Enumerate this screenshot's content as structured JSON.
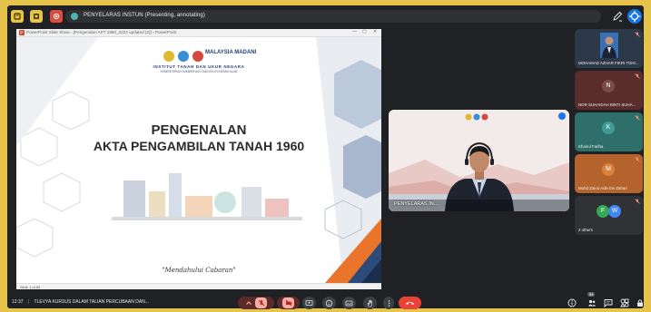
{
  "colors": {
    "frame_border": "#e6c44b",
    "background": "#202124",
    "accent_blue": "#1a73e8",
    "end_call_red": "#ea4335",
    "tile_maroon": "#5a2d2c",
    "tile_teal": "#2e6f6a",
    "tile_orange": "#b3632b"
  },
  "topbar": {
    "presenting_label": "PENYELARAS INSTUN (Presenting, annotating)",
    "icons": [
      "file-icon",
      "board-icon",
      "record-icon",
      "pen-icon",
      "annotate-icon"
    ]
  },
  "presentation": {
    "window_title": "PowerPoint Slide Show - [Pengenalan APT 1960_2024 updated (2)] - PowerPoint",
    "slide": {
      "logo_text": "MALAYSIA MADANI",
      "org_name": "INSTITUT TANAH DAN UKUR NEGARA",
      "org_sub": "KEMENTERIAN SUMBER ASLI DAN KELESTARIAN ALAM",
      "title_line1": "PENGENALAN",
      "title_line2": "AKTA PENGAMBILAN TANAH 1960",
      "motto": "\"Mendahului Cabaran\""
    },
    "status": "Slide 1 of 50"
  },
  "presenter": {
    "name": "PENYELARAS IN..."
  },
  "participants": [
    {
      "name": "MOHAMAD AZHAR FIKRI TOHI...",
      "initial": "",
      "mic": "muted"
    },
    {
      "name": "NOR SUHAIDAH BINTI SUHA...",
      "initial": "N",
      "mic": "muted"
    },
    {
      "name": "Khairul Fariha",
      "initial": "K",
      "mic": "muted"
    },
    {
      "name": "Mohd Zairul Adin bin Zahari",
      "initial": "M",
      "mic": "muted"
    },
    {
      "name": "2 others",
      "initials": [
        "F",
        "W"
      ],
      "mic": "muted"
    }
  ],
  "bottom": {
    "time": "12:37",
    "separator": "|",
    "meeting_name": "TLEVYA KURSUS DALAM TALIAN PERCUBAAN DAN...",
    "participant_count": "99",
    "controls": [
      "mic-options",
      "mic-off",
      "camera-options",
      "camera-off",
      "present",
      "emoji",
      "captions",
      "raise-hand",
      "more-options",
      "end-call"
    ],
    "right_controls": [
      "info",
      "people",
      "chat",
      "activities",
      "host-controls"
    ]
  }
}
